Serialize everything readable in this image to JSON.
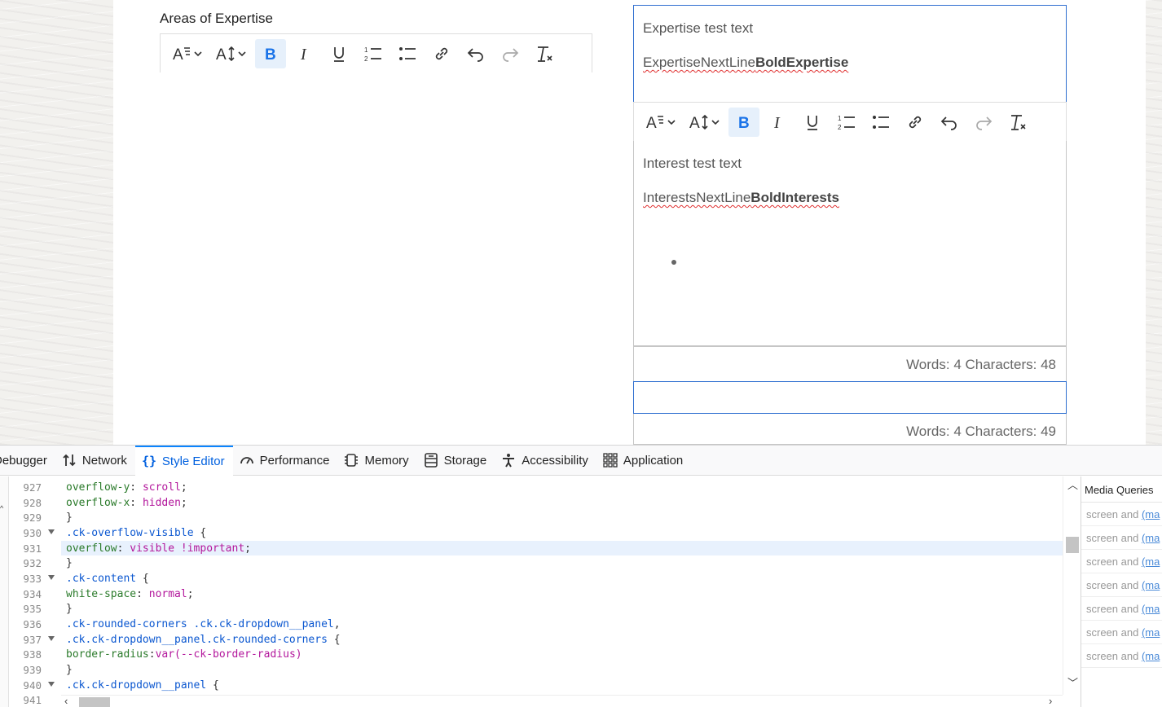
{
  "page": {
    "expertise_label": "Areas of Expertise",
    "expertise_editor": {
      "line1": "Expertise test text",
      "line2_plain": "ExpertiseNextLine",
      "line2_bold": "BoldExpertise"
    },
    "interest_editor": {
      "line1": "Interest test text",
      "line2_plain": "InterestsNextLine",
      "line2_bold": "BoldInterests"
    },
    "counter1": "Words: 4 Characters: 48",
    "counter2": "Words: 4 Characters: 49",
    "toolbar_buttons": [
      "heading",
      "font-size",
      "bold",
      "italic",
      "underline",
      "numbered-list",
      "bulleted-list",
      "link",
      "undo",
      "redo",
      "remove-format"
    ]
  },
  "devtools": {
    "tabs": [
      {
        "label": "Debugger",
        "icon": "debugger-icon"
      },
      {
        "label": "Network",
        "icon": "network-icon"
      },
      {
        "label": "Style Editor",
        "icon": "braces-icon"
      },
      {
        "label": "Performance",
        "icon": "gauge-icon"
      },
      {
        "label": "Memory",
        "icon": "chip-icon"
      },
      {
        "label": "Storage",
        "icon": "storage-icon"
      },
      {
        "label": "Accessibility",
        "icon": "person-icon"
      },
      {
        "label": "Application",
        "icon": "grid-icon"
      }
    ],
    "selected_tab": "Style Editor",
    "line_numbers": [
      "927",
      "928",
      "929",
      "930",
      "931",
      "932",
      "933",
      "934",
      "935",
      "936",
      "937",
      "938",
      "939",
      "940",
      "941"
    ],
    "code_lines": [
      " overflow-y: scroll;",
      " overflow-x: hidden;",
      "}",
      ".ck-overflow-visible {",
      " overflow: visible !important;",
      "}",
      ".ck-content {",
      " white-space: normal;",
      "}",
      ".ck-rounded-corners .ck.ck-dropdown__panel,",
      ".ck.ck-dropdown__panel.ck-rounded-corners {",
      " border-radius:var(--ck-border-radius)",
      "}",
      ".ck.ck-dropdown__panel {",
      ""
    ],
    "media_queries": {
      "title": "Media Queries",
      "rows": [
        "screen and",
        "screen and",
        "screen and",
        "screen and",
        "screen and",
        "screen and",
        "screen and"
      ],
      "link_text": "(ma"
    },
    "colors": {
      "selected_tab": "#0060df",
      "selector": "#0b57d0",
      "property": "#2a7a2a",
      "value": "#b3179c"
    }
  }
}
